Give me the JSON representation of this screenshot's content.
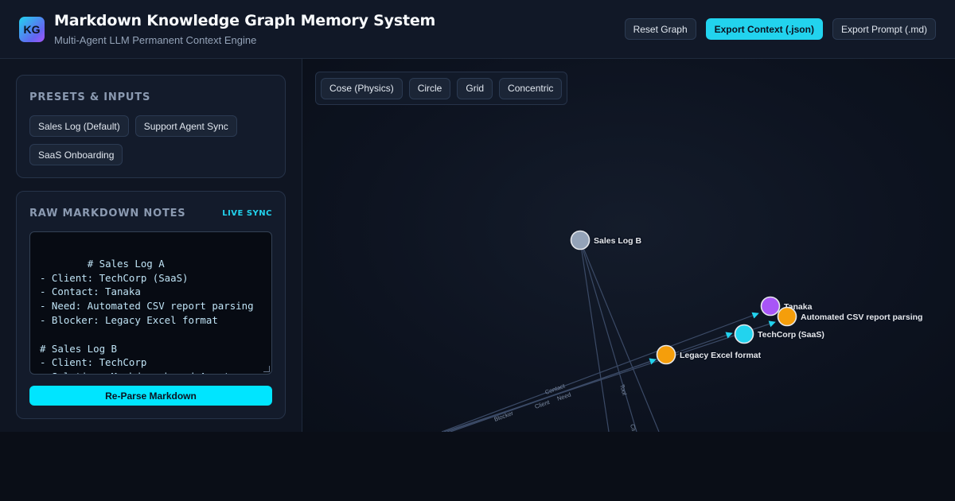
{
  "header": {
    "logo_text": "KG",
    "title": "Markdown Knowledge Graph Memory System",
    "subtitle": "Multi-Agent LLM Permanent Context Engine",
    "actions": {
      "reset": "Reset Graph",
      "export_json": "Export Context (.json)",
      "export_md": "Export Prompt (.md)"
    }
  },
  "sidebar": {
    "presets": {
      "title": "PRESETS & INPUTS",
      "items": [
        "Sales Log (Default)",
        "Support Agent Sync",
        "SaaS Onboarding"
      ]
    },
    "raw": {
      "title": "RAW MARKDOWN NOTES",
      "badge": "LIVE SYNC",
      "content": "# Sales Log A\n- Client: TechCorp (SaaS)\n- Contact: Tanaka\n- Need: Automated CSV report parsing\n- Blocker: Legacy Excel format\n\n# Sales Log B\n- Client: TechCorp\n- Solution: Markdown-based Agent\nM",
      "button": "Re-Parse Markdown"
    }
  },
  "graph": {
    "layouts": [
      "Cose (Physics)",
      "Circle",
      "Grid",
      "Concentric"
    ],
    "nodes": [
      {
        "id": "sales-log-b",
        "label": "Sales Log B",
        "color": "#94a3b8"
      },
      {
        "id": "tanaka",
        "label": "Tanaka",
        "color": "#a855f7"
      },
      {
        "id": "csv",
        "label": "Automated CSV report parsing",
        "color": "#f59e0b"
      },
      {
        "id": "techcorp",
        "label": "TechCorp (SaaS)",
        "color": "#22d3ee"
      },
      {
        "id": "excel",
        "label": "Legacy Excel format",
        "color": "#f59e0b"
      }
    ],
    "edge_labels": [
      "Contact",
      "Client",
      "Need",
      "Blocker",
      "Tool",
      "Cli"
    ]
  },
  "colors": {
    "accent": "#22d3ee",
    "person": "#a855f7",
    "issue": "#f59e0b",
    "log": "#94a3b8"
  }
}
